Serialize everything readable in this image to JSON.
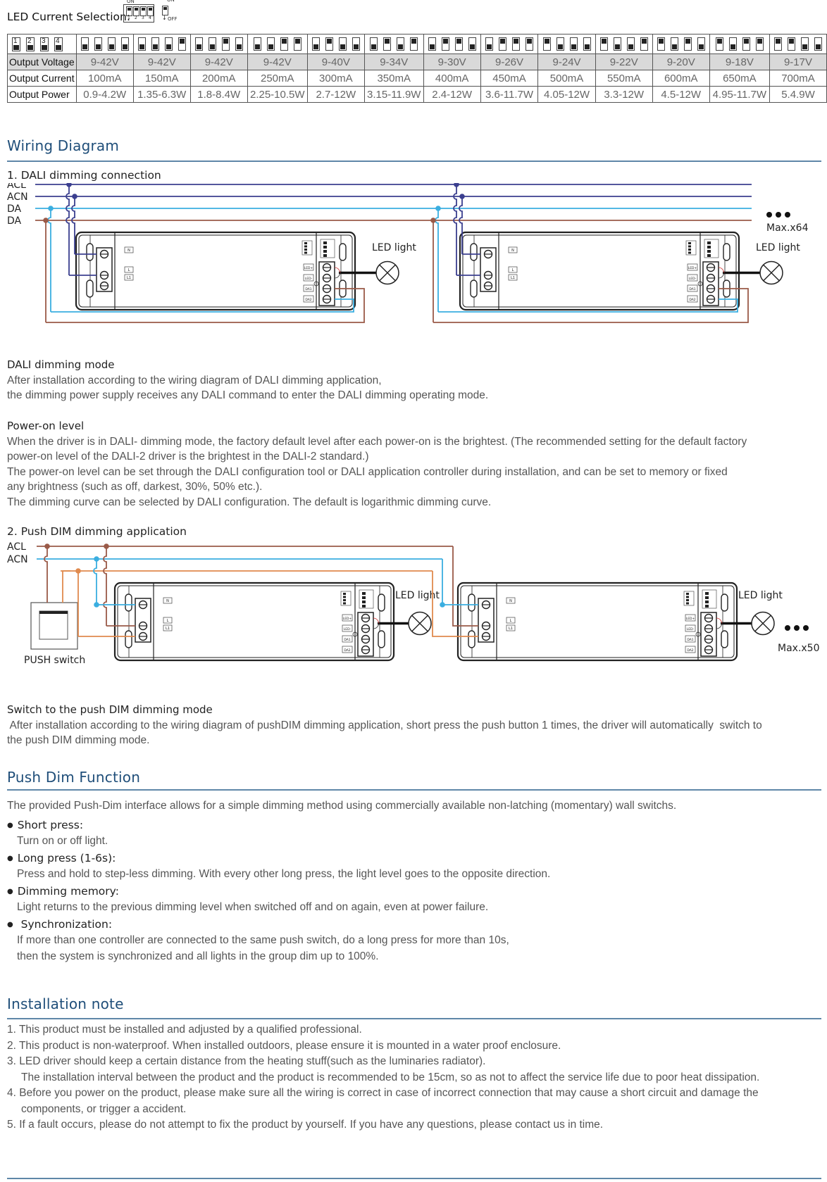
{
  "current_selection": {
    "label": "LED Current Selection:",
    "legend": {
      "on": "ON",
      "off": "OFF",
      "numbers": [
        "1",
        "2",
        "3",
        "4"
      ]
    }
  },
  "spec_table": {
    "header_switch_numbers": [
      "1",
      "2",
      "3",
      "4"
    ],
    "row_labels": [
      "Output Voltage",
      "Output Current",
      "Output Power"
    ],
    "columns": [
      {
        "dip": [
          0,
          0,
          0,
          0
        ],
        "voltage": "9-42V",
        "current": "100mA",
        "power": "0.9-4.2W"
      },
      {
        "dip": [
          0,
          0,
          0,
          1
        ],
        "voltage": "9-42V",
        "current": "150mA",
        "power": "1.35-6.3W"
      },
      {
        "dip": [
          0,
          0,
          1,
          0
        ],
        "voltage": "9-42V",
        "current": "200mA",
        "power": "1.8-8.4W"
      },
      {
        "dip": [
          0,
          0,
          1,
          1
        ],
        "voltage": "9-42V",
        "current": "250mA",
        "power": "2.25-10.5W"
      },
      {
        "dip": [
          0,
          1,
          0,
          0
        ],
        "voltage": "9-40V",
        "current": "300mA",
        "power": "2.7-12W"
      },
      {
        "dip": [
          0,
          1,
          0,
          1
        ],
        "voltage": "9-34V",
        "current": "350mA",
        "power": "3.15-11.9W"
      },
      {
        "dip": [
          0,
          1,
          1,
          0
        ],
        "voltage": "9-30V",
        "current": "400mA",
        "power": "2.4-12W"
      },
      {
        "dip": [
          0,
          1,
          1,
          1
        ],
        "voltage": "9-26V",
        "current": "450mA",
        "power": "3.6-11.7W"
      },
      {
        "dip": [
          1,
          0,
          0,
          0
        ],
        "voltage": "9-24V",
        "current": "500mA",
        "power": "4.05-12W"
      },
      {
        "dip": [
          1,
          0,
          0,
          1
        ],
        "voltage": "9-22V",
        "current": "550mA",
        "power": "3.3-12W"
      },
      {
        "dip": [
          1,
          0,
          1,
          0
        ],
        "voltage": "9-20V",
        "current": "600mA",
        "power": "4.5-12W"
      },
      {
        "dip": [
          1,
          0,
          1,
          1
        ],
        "voltage": "9-18V",
        "current": "650mA",
        "power": "4.95-11.7W"
      },
      {
        "dip": [
          1,
          1,
          0,
          0
        ],
        "voltage": "9-17V",
        "current": "700mA",
        "power": "5.4.9W"
      }
    ]
  },
  "wiring": {
    "title": "Wiring Diagram",
    "dali": {
      "subtitle": "1. DALI dimming connection",
      "bus_labels": [
        "ACL",
        "ACN",
        "DA",
        "DA"
      ],
      "led_label": "LED light",
      "max_label": "Max.x64",
      "terminal_labels": [
        "N",
        "L",
        "L1",
        "LED+",
        "LED-",
        "DA1",
        "DA2"
      ],
      "wire_colors": {
        "ac": "#3b3f8f",
        "da1": "#3aaee0",
        "da2": "#9a5a48"
      }
    },
    "dali_mode": {
      "title": "DALI dimming mode",
      "lines": [
        "After installation according to the wiring diagram of DALI dimming application,",
        "the dimming power supply receives any DALI command to enter the DALI dimming operating mode."
      ]
    },
    "power_on": {
      "title": "Power-on level",
      "lines": [
        "When the driver is in DALI- dimming mode, the factory default level after each power-on is the brightest. (The recommended setting for the default factory",
        "power-on level of the DALI-2 driver is the brightest in the DALI-2 standard.)",
        "The power-on level can be set through the DALI configuration tool or DALI application controller during installation, and can be set to memory or fixed",
        "any brightness (such as off, darkest, 30%, 50% etc.).",
        "The dimming curve can be selected by DALI configuration. The default is logarithmic dimming curve."
      ]
    },
    "push": {
      "subtitle": "2. Push DIM dimming application",
      "bus_labels": [
        "ACL",
        "ACN"
      ],
      "switch_label": "PUSH switch",
      "led_label": "LED light",
      "max_label": "Max.x50",
      "wire_colors": {
        "acl": "#9a5a48",
        "acn": "#3aaee0",
        "sw": "#e08a4e"
      }
    },
    "push_mode": {
      "title": "Switch to the push DIM dimming mode",
      "lines": [
        " After installation according to the wiring diagram of pushDIM dimming application, short press the push button 1 times, the driver will automatically  switch to",
        "the push DIM dimming mode."
      ]
    }
  },
  "push_dim": {
    "title": "Push Dim Function",
    "intro": "The provided Push-Dim interface allows for a simple dimming method using commercially available non-latching (momentary) wall switchs.",
    "items": [
      {
        "title": "Short press:",
        "lines": [
          "Turn on or off light."
        ]
      },
      {
        "title": "Long press (1-6s):",
        "lines": [
          "Press and hold to step-less dimming. With every other long press, the light level goes to the opposite direction."
        ]
      },
      {
        "title": "Dimming memory:",
        "lines": [
          "Light returns to the previous dimming level when switched off and on again, even at power failure."
        ]
      },
      {
        "title": " Synchronization:",
        "lines": [
          "If more than one controller are connected to the same push switch, do a long press for more than 10s,",
          "then the system is synchronized and all lights in the group dim up to 100%."
        ]
      }
    ]
  },
  "installation": {
    "title": "Installation note",
    "notes": [
      {
        "text": "1. This product must be installed and adjusted by a qualified professional.",
        "cont": null
      },
      {
        "text": "2. This product is non-waterproof. When installed outdoors, please ensure it is mounted in a water proof enclosure.",
        "cont": null
      },
      {
        "text": "3. LED driver should keep a certain distance from the heating stuff(such as the luminaries radiator).",
        "cont": "The installation interval between the product and the product is recommended to be 15cm, so as not to affect the service life due to poor heat dissipation."
      },
      {
        "text": "4. Before you power on the product, please make sure all the wiring is correct in case of incorrect connection that may cause a short circuit and damage the",
        "cont": "components, or trigger a accident."
      },
      {
        "text": "5. If a fault occurs, please do not attempt to fix the product by yourself. If you have any questions, please contact us in time.",
        "cont": null
      }
    ]
  },
  "colors": {
    "heading": "#1f4e79",
    "rule": "#5f87a8",
    "table_header_bg": "#d9d9d9"
  }
}
